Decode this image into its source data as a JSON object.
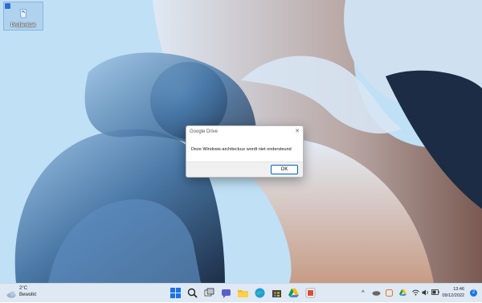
{
  "desktop": {
    "icons": [
      {
        "label": "Prullenbak",
        "icon": "recycle-bin-icon"
      }
    ]
  },
  "dialog": {
    "title": "Google Drive",
    "message": "Deze Windows-architectuur wordt niet ondersteund",
    "ok_label": "OK",
    "close_symbol": "✕"
  },
  "taskbar": {
    "weather": {
      "temp": "2°C",
      "condition": "Bewolkt"
    },
    "apps": [
      "windows-start-icon",
      "search-icon",
      "task-view-icon",
      "teams-chat-icon",
      "edge-icon",
      "file-explorer-icon",
      "store-icon",
      "google-drive-icon",
      "app-icon"
    ],
    "tray": {
      "chevron": "^"
    },
    "clock": {
      "time": "13:46",
      "date": "09/12/2022"
    },
    "notification_count": "2"
  },
  "colors": {
    "accent": "#0067c0",
    "taskbar": "#dfe9f3",
    "wallpaper": "#bfe0f5"
  }
}
